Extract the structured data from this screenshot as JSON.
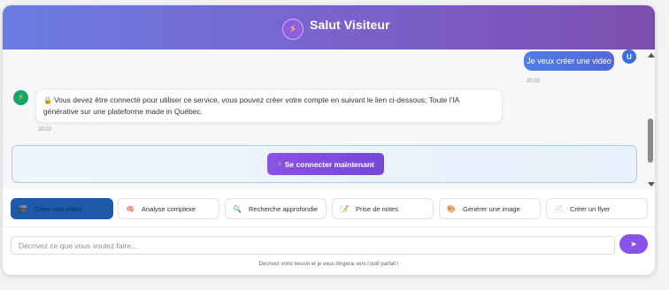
{
  "header": {
    "avatar_icon": "⚡",
    "title": "Salut Visiteur"
  },
  "messages": {
    "user": {
      "avatar": "U",
      "text": "Je veux créer une vidéo",
      "time": "20:02"
    },
    "bot": {
      "avatar_icon": "⚡",
      "lock_icon": "🔒",
      "text": "Vous devez être connecté pour utiliser ce service, vous pouvez créer votre compte en suivant le lien ci-dessous; Toute l'IA générative sur une plateforme made in Québec.",
      "time": "20:02"
    }
  },
  "login": {
    "bolt_icon": "⚡",
    "label": "Se connecter maintenant"
  },
  "tools": [
    {
      "icon": "🎬",
      "label": "Créer une vidéo",
      "active": true
    },
    {
      "icon": "🧠",
      "label": "Analyse complexe",
      "active": false
    },
    {
      "icon": "🔍",
      "label": "Recherche approfondie",
      "active": false
    },
    {
      "icon": "📝",
      "label": "Prise de notes",
      "active": false
    },
    {
      "icon": "🎨",
      "label": "Générer une image",
      "active": false
    },
    {
      "icon": "📄",
      "label": "Créer un flyer",
      "active": false
    }
  ],
  "input": {
    "placeholder": "Décrivez ce que vous voulez faire...",
    "value": ""
  },
  "send_icon": "➤",
  "hint": "Décrivez votre besoin et je vous dirigerai vers l'outil parfait !",
  "colors": {
    "accent": "#8a52e8",
    "header_start": "#6b7de3",
    "header_end": "#7c4fae",
    "active_tool": "#1e5aa8"
  }
}
